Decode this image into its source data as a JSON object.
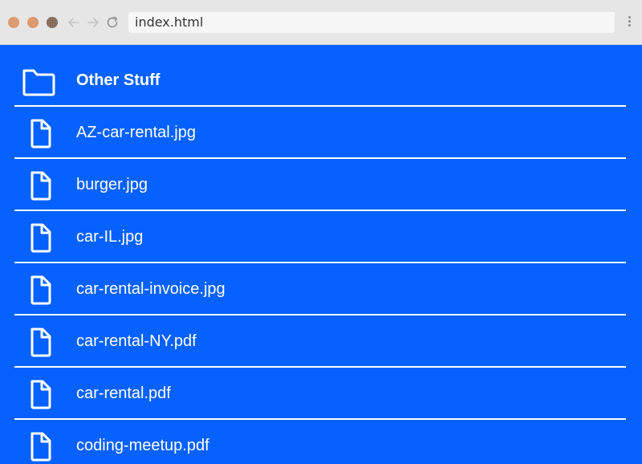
{
  "browser": {
    "address_text": "index.html",
    "back_icon": "arrow-left",
    "forward_icon": "arrow-right",
    "reload_icon": "reload",
    "menu_icon": "vertical-dots"
  },
  "colors": {
    "background": "#0561ff",
    "text": "#ffffff",
    "chrome": "#e6e6e6"
  },
  "entries": [
    {
      "type": "folder",
      "icon": "folder-icon",
      "name": "Other Stuff"
    },
    {
      "type": "file",
      "icon": "file-icon",
      "name": "AZ-car-rental.jpg"
    },
    {
      "type": "file",
      "icon": "file-icon",
      "name": "burger.jpg"
    },
    {
      "type": "file",
      "icon": "file-icon",
      "name": "car-IL.jpg"
    },
    {
      "type": "file",
      "icon": "file-icon",
      "name": "car-rental-invoice.jpg"
    },
    {
      "type": "file",
      "icon": "file-icon",
      "name": "car-rental-NY.pdf"
    },
    {
      "type": "file",
      "icon": "file-icon",
      "name": "car-rental.pdf"
    },
    {
      "type": "file",
      "icon": "file-icon",
      "name": "coding-meetup.pdf"
    }
  ]
}
